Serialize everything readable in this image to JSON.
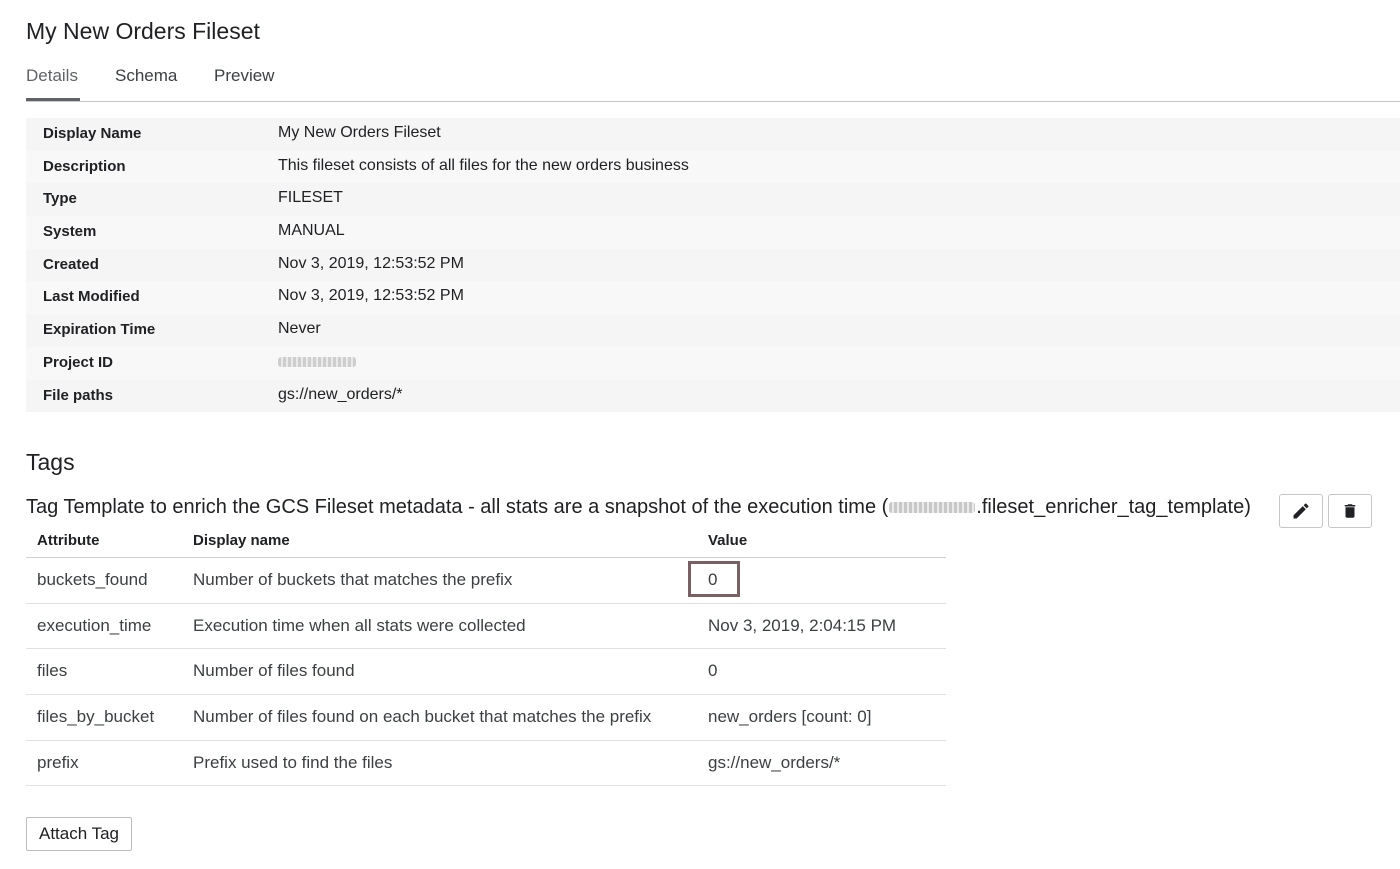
{
  "page": {
    "title": "My New Orders Fileset"
  },
  "tabs": [
    "Details",
    "Schema",
    "Preview"
  ],
  "details": [
    {
      "label": "Display Name",
      "value": "My New Orders Fileset"
    },
    {
      "label": "Description",
      "value": "This fileset consists of all files for the new orders business"
    },
    {
      "label": "Type",
      "value": "FILESET"
    },
    {
      "label": "System",
      "value": "MANUAL"
    },
    {
      "label": "Created",
      "value": "Nov 3, 2019, 12:53:52 PM"
    },
    {
      "label": "Last Modified",
      "value": "Nov 3, 2019, 12:53:52 PM"
    },
    {
      "label": "Expiration Time",
      "value": "Never"
    },
    {
      "label": "Project ID",
      "value": ""
    },
    {
      "label": "File paths",
      "value": "gs://new_orders/*"
    }
  ],
  "tags": {
    "heading": "Tags",
    "template_text_before": "Tag Template to enrich the GCS Fileset metadata - all stats are a snapshot of the execution time (",
    "template_text_after": ".fileset_enricher_tag_template)",
    "columns": [
      "Attribute",
      "Display name",
      "Value"
    ],
    "rows": [
      {
        "attribute": "buckets_found",
        "display_name": "Number of buckets that matches the prefix",
        "value": "0"
      },
      {
        "attribute": "execution_time",
        "display_name": "Execution time when all stats were collected",
        "value": "Nov 3, 2019, 2:04:15 PM"
      },
      {
        "attribute": "files",
        "display_name": "Number of files found",
        "value": "0"
      },
      {
        "attribute": "files_by_bucket",
        "display_name": "Number of files found on each bucket that matches the prefix",
        "value": "new_orders [count: 0]"
      },
      {
        "attribute": "prefix",
        "display_name": "Prefix used to find the files",
        "value": "gs://new_orders/*"
      }
    ],
    "edit_icon": "pencil-icon",
    "delete_icon": "trash-icon",
    "attach_label": "Attach Tag"
  },
  "colors": {
    "highlight_box": "#7a5f63",
    "tab_indicator": "#5f6368"
  }
}
